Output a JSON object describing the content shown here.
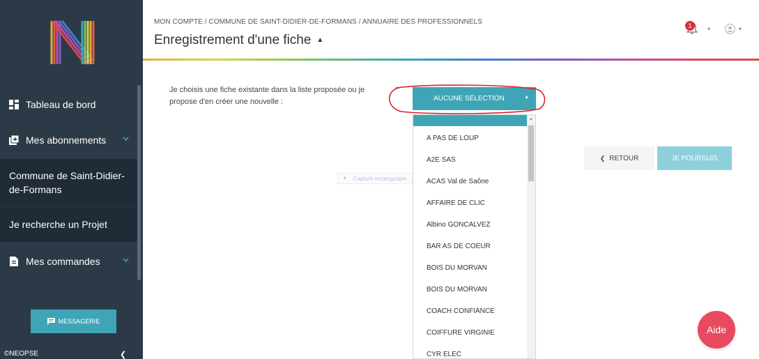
{
  "sidebar": {
    "items": [
      {
        "label": "Tableau de bord",
        "icon": "dashboard-icon"
      },
      {
        "label": "Mes abonnements",
        "icon": "subscriptions-icon"
      },
      {
        "label": "Commune de Saint-Didier-de-Formans"
      },
      {
        "label": "Je recherche un Projet"
      },
      {
        "label": "Mes commandes",
        "icon": "orders-icon"
      }
    ],
    "message_button": "MESSAGERIE",
    "copyright": "©NEOPSE"
  },
  "header": {
    "breadcrumb": "MON COMPTE / COMMUNE DE SAINT-DIDIER-DE-FORMANS / ANNUAIRE DES PROFESSIONNELS",
    "title": "Enregistrement d'une fiche",
    "notification_count": "1"
  },
  "form": {
    "prompt": "Je choisis une fiche existante dans la liste proposée ou je propose d'en créer une nouvelle :",
    "select_value": "AUCUNE SÉLECTION",
    "options": [
      "",
      "A PAS DE LOUP",
      "A2E SAS",
      "ACAS Val de Saône",
      "AFFAIRE DE CLIC",
      "Albino GONCALVEZ",
      "BAR AS DE COEUR",
      "BOIS DU MORVAN",
      "BOIS DU MORVAN",
      "COACH CONFIANCE",
      "COIFFURE VIRGINIE",
      "CYR ELEC"
    ],
    "back_button": "RETOUR",
    "next_button": "JE POURSUIS"
  },
  "overlay": {
    "tooltip": "Capture rectangulaire"
  },
  "help_button": "Aide",
  "colors": {
    "sidebar_bg": "#2c3a47",
    "accent": "#3fa5b6",
    "help": "#e84a5f",
    "annotation": "#d9232d"
  }
}
